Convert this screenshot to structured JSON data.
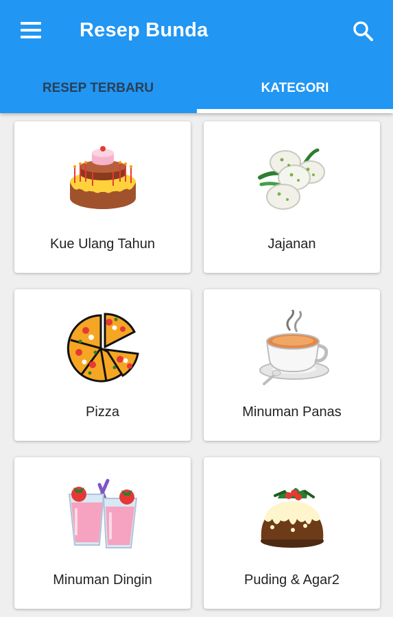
{
  "app": {
    "title": "Resep Bunda"
  },
  "tabs": [
    {
      "label": "RESEP TERBARU",
      "selected": false
    },
    {
      "label": "KATEGORI",
      "selected": true
    }
  ],
  "colors": {
    "primary": "#2196f3",
    "tab_inactive_text": "#2a3f55",
    "background": "#efefef"
  },
  "icons": {
    "menu": "hamburger-menu-icon",
    "search": "search-icon"
  },
  "categories": [
    {
      "label": "Kue Ulang Tahun",
      "icon": "birthday-cake-icon"
    },
    {
      "label": "Jajanan",
      "icon": "snack-icon"
    },
    {
      "label": "Pizza",
      "icon": "pizza-icon"
    },
    {
      "label": "Minuman Panas",
      "icon": "hot-drink-icon"
    },
    {
      "label": "Minuman Dingin",
      "icon": "cold-drink-icon"
    },
    {
      "label": "Puding & Agar2",
      "icon": "pudding-icon"
    }
  ]
}
